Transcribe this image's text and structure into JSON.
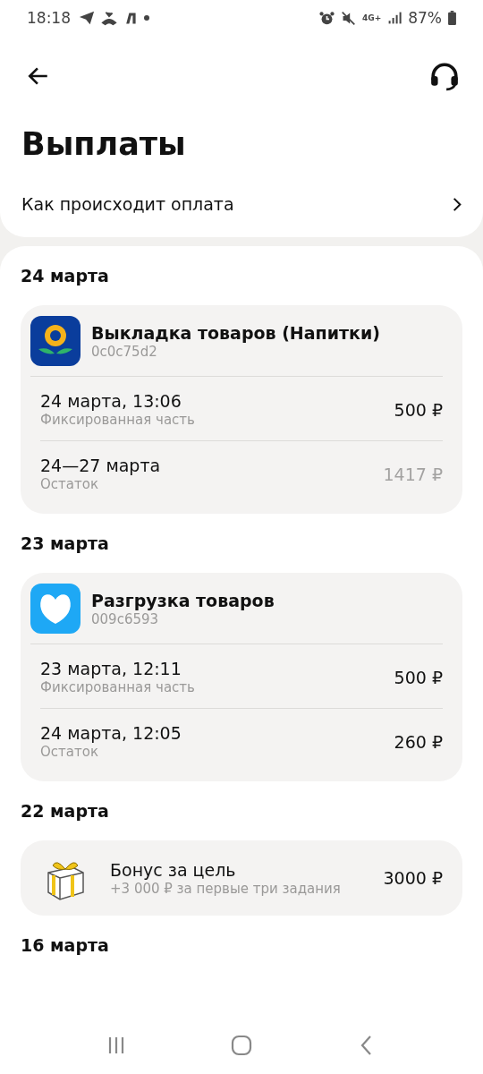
{
  "status_bar": {
    "time": "18:18",
    "network": "4G+",
    "battery": "87%"
  },
  "title": "Выплаты",
  "info_link": "Как происходит оплата",
  "groups": [
    {
      "date": "24 марта",
      "items": [
        {
          "kind": "task",
          "title": "Выкладка товаров (Напитки)",
          "code": "0c0c75d2",
          "payments": [
            {
              "date": "24 марта, 13:06",
              "type": "Фиксированная часть",
              "amount": "500 ₽",
              "pending": false
            },
            {
              "date": "24—27 марта",
              "type": "Остаток",
              "amount": "1417 ₽",
              "pending": true
            }
          ]
        }
      ]
    },
    {
      "date": "23 марта",
      "items": [
        {
          "kind": "task",
          "title": "Разгрузка товаров",
          "code": "009c6593",
          "payments": [
            {
              "date": "23 марта, 12:11",
              "type": "Фиксированная часть",
              "amount": "500 ₽",
              "pending": false
            },
            {
              "date": "24 марта, 12:05",
              "type": "Остаток",
              "amount": "260 ₽",
              "pending": false
            }
          ]
        }
      ]
    },
    {
      "date": "22 марта",
      "items": [
        {
          "kind": "bonus",
          "title": "Бонус за цель",
          "note": "+3 000 ₽ за первые три задания",
          "amount": "3000 ₽"
        }
      ]
    },
    {
      "date": "16 марта"
    }
  ]
}
